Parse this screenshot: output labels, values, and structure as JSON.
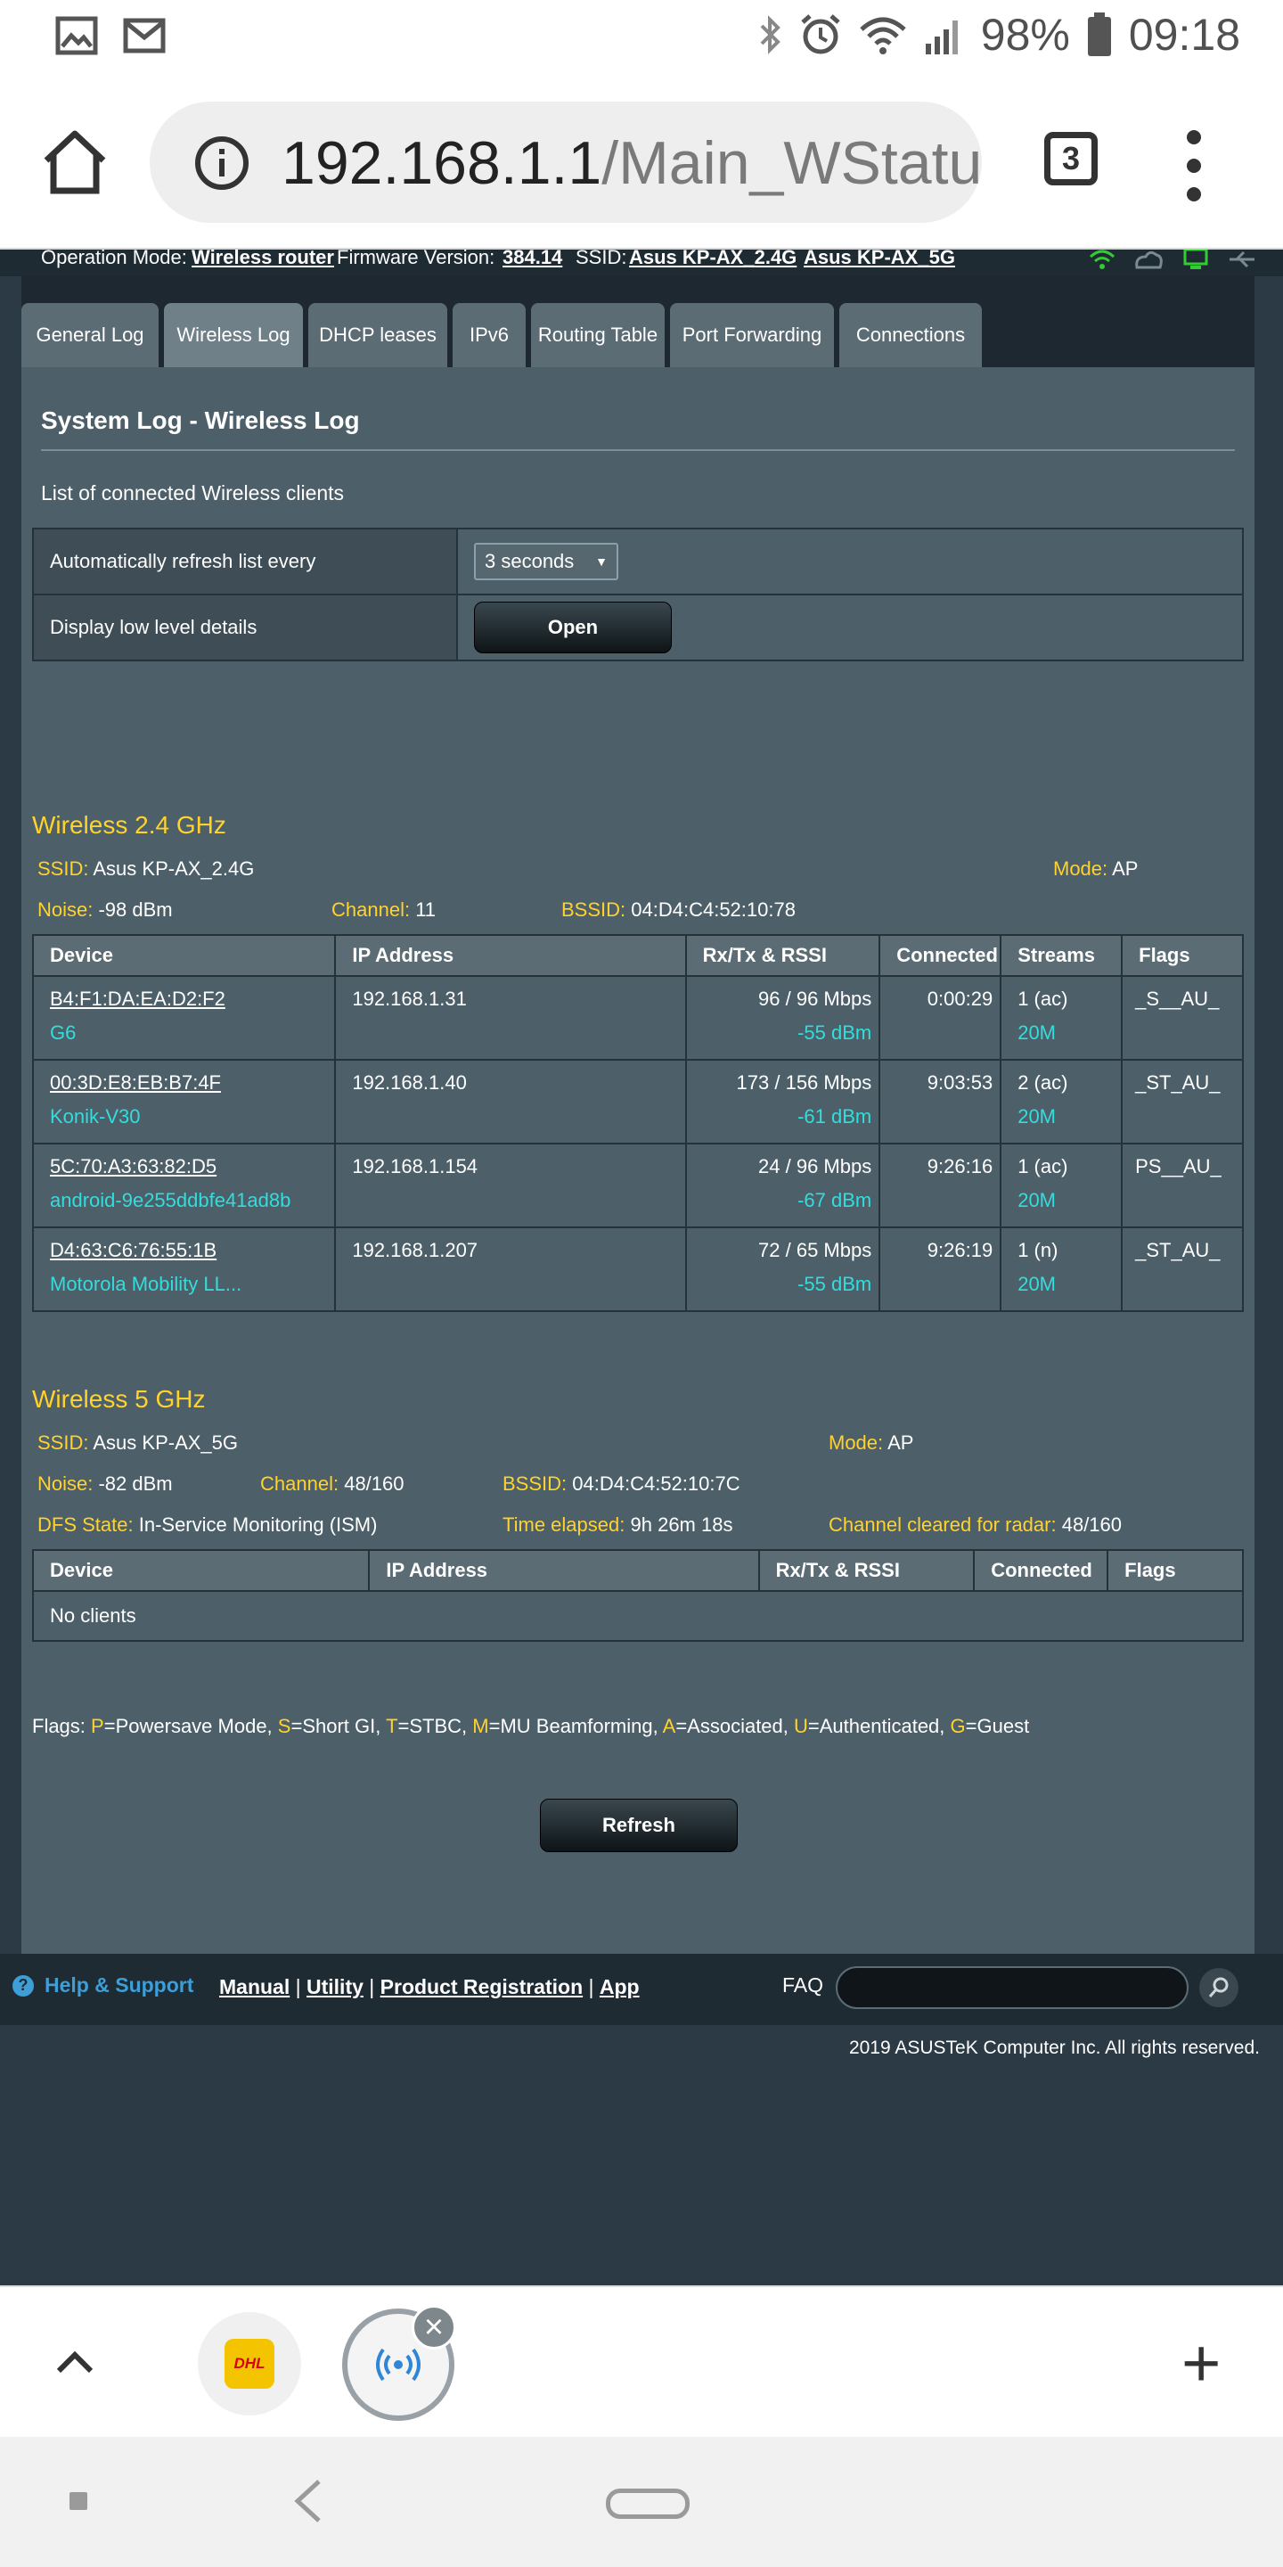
{
  "status_bar": {
    "battery": "98%",
    "time": "09:18",
    "icons": [
      "image-icon",
      "gmail-icon",
      "bluetooth-icon",
      "alarm-icon",
      "wifi-icon",
      "signal-icon",
      "battery-icon"
    ]
  },
  "browser": {
    "url_host": "192.168.1.1",
    "url_path": "/Main_WStatus_",
    "tab_count": "3"
  },
  "router_info": {
    "op_mode_label": "Operation Mode:",
    "op_mode_value": "Wireless router",
    "fw_label": "Firmware Version:",
    "fw_value": "384.14",
    "ssid_label": "SSID:",
    "ssid_24": "Asus KP-AX_2.4G",
    "ssid_5": "Asus KP-AX_5G"
  },
  "tabs": [
    {
      "label": "General Log"
    },
    {
      "label": "Wireless Log"
    },
    {
      "label": "DHCP leases"
    },
    {
      "label": "IPv6"
    },
    {
      "label": "Routing Table"
    },
    {
      "label": "Port Forwarding"
    },
    {
      "label": "Connections"
    }
  ],
  "section": {
    "title": "System Log - Wireless Log",
    "description": "List of connected Wireless clients"
  },
  "options": {
    "refresh_label": "Automatically refresh list every",
    "refresh_value": "3 seconds",
    "details_label": "Display low level details",
    "details_button": "Open"
  },
  "band24": {
    "title": "Wireless 2.4 GHz",
    "ssid_label": "SSID:",
    "ssid": "Asus KP-AX_2.4G",
    "mode_label": "Mode:",
    "mode": "AP",
    "noise_label": "Noise:",
    "noise": "-98 dBm",
    "channel_label": "Channel:",
    "channel": "11",
    "bssid_label": "BSSID:",
    "bssid": "04:D4:C4:52:10:78",
    "headers": [
      "Device",
      "IP Address",
      "Rx/Tx & RSSI",
      "Connected",
      "Streams",
      "Flags"
    ],
    "clients": [
      {
        "mac": "B4:F1:DA:EA:D2:F2",
        "name": "G6",
        "ip": "192.168.1.31",
        "rate": "96 / 96 Mbps",
        "rssi": "-55 dBm",
        "connected": "0:00:29",
        "streams": "1 (ac)",
        "bw": "20M",
        "flags": "_S__AU_"
      },
      {
        "mac": "00:3D:E8:EB:B7:4F",
        "name": "Konik-V30",
        "ip": "192.168.1.40",
        "rate": "173 / 156 Mbps",
        "rssi": "-61 dBm",
        "connected": "9:03:53",
        "streams": "2 (ac)",
        "bw": "20M",
        "flags": "_ST_AU_"
      },
      {
        "mac": "5C:70:A3:63:82:D5",
        "name": "android-9e255ddbfe41ad8b",
        "ip": "192.168.1.154",
        "rate": "24 / 96 Mbps",
        "rssi": "-67 dBm",
        "connected": "9:26:16",
        "streams": "1 (ac)",
        "bw": "20M",
        "flags": "PS__AU_"
      },
      {
        "mac": "D4:63:C6:76:55:1B",
        "name": "Motorola Mobility LL...",
        "ip": "192.168.1.207",
        "rate": "72 / 65 Mbps",
        "rssi": "-55 dBm",
        "connected": "9:26:19",
        "streams": "1 (n)",
        "bw": "20M",
        "flags": "_ST_AU_"
      }
    ]
  },
  "band5": {
    "title": "Wireless 5 GHz",
    "ssid_label": "SSID:",
    "ssid": "Asus KP-AX_5G",
    "mode_label": "Mode:",
    "mode": "AP",
    "noise_label": "Noise:",
    "noise": "-82 dBm",
    "channel_label": "Channel:",
    "channel": "48/160",
    "bssid_label": "BSSID:",
    "bssid": "04:D4:C4:52:10:7C",
    "dfs_label": "DFS State:",
    "dfs": "In-Service Monitoring (ISM)",
    "elapsed_label": "Time elapsed:",
    "elapsed": "9h 26m 18s",
    "cleared_label": "Channel cleared for radar:",
    "cleared": "48/160",
    "headers": [
      "Device",
      "IP Address",
      "Rx/Tx & RSSI",
      "Connected",
      "Flags"
    ],
    "empty": "No clients"
  },
  "flags_legend": {
    "prefix": "Flags:",
    "items": [
      {
        "k": "P",
        "v": "=Powersave Mode, "
      },
      {
        "k": "S",
        "v": "=Short GI, "
      },
      {
        "k": "T",
        "v": "=STBC, "
      },
      {
        "k": "M",
        "v": "=MU Beamforming, "
      },
      {
        "k": "A",
        "v": "=Associated, "
      },
      {
        "k": "U",
        "v": "=Authenticated, "
      },
      {
        "k": "G",
        "v": "=Guest"
      }
    ]
  },
  "refresh_button": "Refresh",
  "footer": {
    "help": "Help & Support",
    "manual": "Manual",
    "utility": "Utility",
    "registration": "Product Registration",
    "app": "App",
    "faq": "FAQ",
    "copyright": "2019 ASUSTeK Computer Inc. All rights reserved."
  },
  "bubbles": {
    "dhl_text": "DHL"
  },
  "colors": {
    "accent_yellow": "#ffd22e",
    "cyan": "#33dddd",
    "page_bg": "#2b3a44",
    "panel_bg": "#4d5f68"
  }
}
